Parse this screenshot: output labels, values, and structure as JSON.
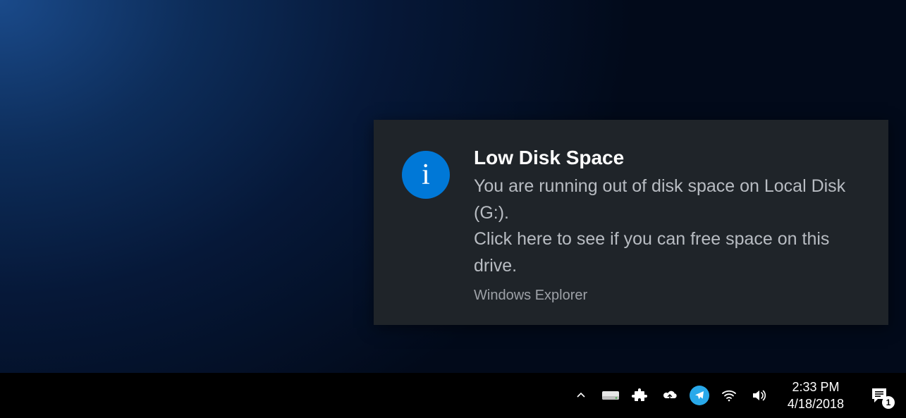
{
  "notification": {
    "title": "Low Disk Space",
    "message": "You are running out of disk space on Local Disk (G:).\nClick here to see if you can free space on this drive.",
    "source": "Windows Explorer",
    "icon_glyph": "i"
  },
  "taskbar": {
    "time": "2:33 PM",
    "date": "4/18/2018",
    "notification_count": "1",
    "icons": {
      "chevron": "show-hidden-icons",
      "drive": "drive-icon",
      "puzzle": "extension-icon",
      "cloud": "cloud-sync-icon",
      "telegram": "telegram-icon",
      "wifi": "wifi-icon",
      "volume": "volume-icon",
      "action_center": "action-center-icon"
    }
  }
}
